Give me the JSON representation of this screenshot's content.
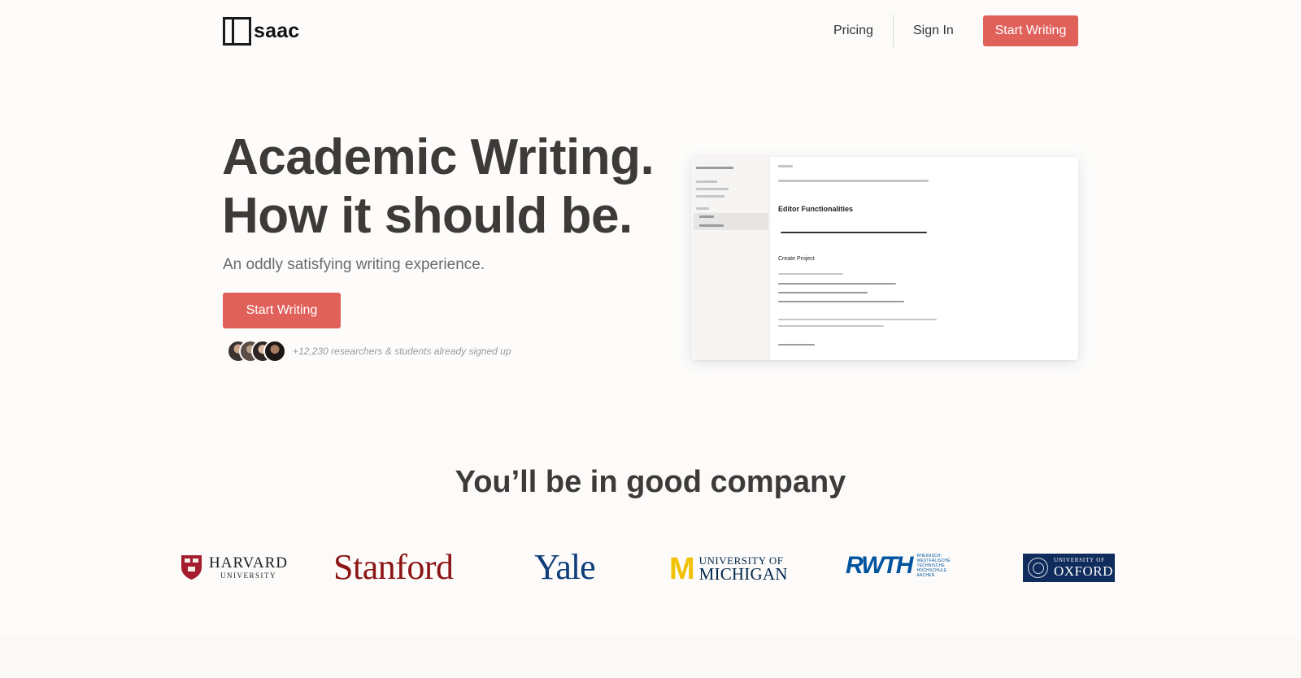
{
  "header": {
    "logo_text": "saac",
    "nav": {
      "pricing": "Pricing",
      "sign_in": "Sign In",
      "start_writing": "Start Writing"
    }
  },
  "hero": {
    "title_line1": "Academic Writing.",
    "title_line2": "How it should be.",
    "subtitle": "An oddly satisfying writing experience.",
    "cta": "Start Writing",
    "social_proof": "+12,230 researchers & students already signed up"
  },
  "preview": {
    "heading": "Editor Functionalities",
    "section_heading": "Create Project"
  },
  "company": {
    "title": "You’ll be in good company",
    "logos": {
      "harvard_main": "HARVARD",
      "harvard_sub": "UNIVERSITY",
      "stanford": "Stanford",
      "yale": "Yale",
      "michigan_mark": "M",
      "michigan_top": "UNIVERSITY OF",
      "michigan_bottom": "MICHIGAN",
      "rwth": "RWTH",
      "rwth_small": "RHEINISCH- WESTFÄLISCHE TECHNISCHE HOCHSCHULE AACHEN",
      "oxford_top": "UNIVERSITY OF",
      "oxford_bottom": "OXFORD"
    }
  },
  "colors": {
    "accent": "#e0605a",
    "heading": "#3d3b39",
    "stanford": "#8c1515",
    "yale": "#0f3d7a",
    "michigan_maize": "#f1c203",
    "michigan_blue": "#00274c",
    "rwth": "#00549f",
    "oxford": "#0f2c5c"
  }
}
